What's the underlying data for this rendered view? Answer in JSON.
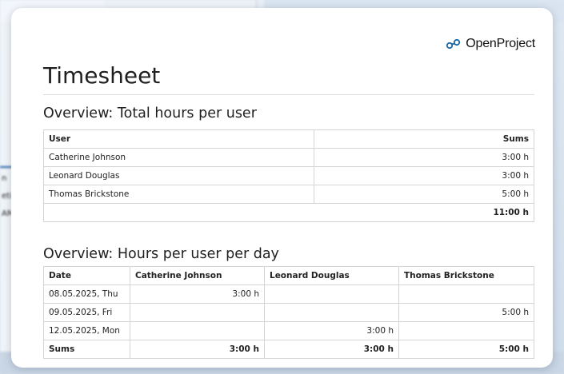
{
  "brand": {
    "name": "OpenProject",
    "logo_icon": "openproject-logo-icon",
    "accent": "#1a67a3"
  },
  "title": "Timesheet",
  "background_app": {
    "side_text": [
      "n",
      "eti",
      "AM"
    ]
  },
  "overview_total": {
    "heading": "Overview: Total hours per user",
    "columns": [
      "User",
      "Sums"
    ],
    "rows": [
      {
        "user": "Catherine Johnson",
        "sum": "3:00 h"
      },
      {
        "user": "Leonard Douglas",
        "sum": "3:00 h"
      },
      {
        "user": "Thomas Brickstone",
        "sum": "5:00 h"
      }
    ],
    "total": "11:00 h"
  },
  "overview_daily": {
    "heading": "Overview: Hours per user per day",
    "columns": [
      "Date",
      "Catherine Johnson",
      "Leonard Douglas",
      "Thomas Brickstone"
    ],
    "rows": [
      {
        "date": "08.05.2025, Thu",
        "cj": "3:00 h",
        "ld": "",
        "tb": ""
      },
      {
        "date": "09.05.2025, Fri",
        "cj": "",
        "ld": "",
        "tb": "5:00 h"
      },
      {
        "date": "12.05.2025, Mon",
        "cj": "",
        "ld": "3:00 h",
        "tb": ""
      }
    ],
    "sums": {
      "label": "Sums",
      "cj": "3:00 h",
      "ld": "3:00 h",
      "tb": "5:00 h"
    }
  }
}
